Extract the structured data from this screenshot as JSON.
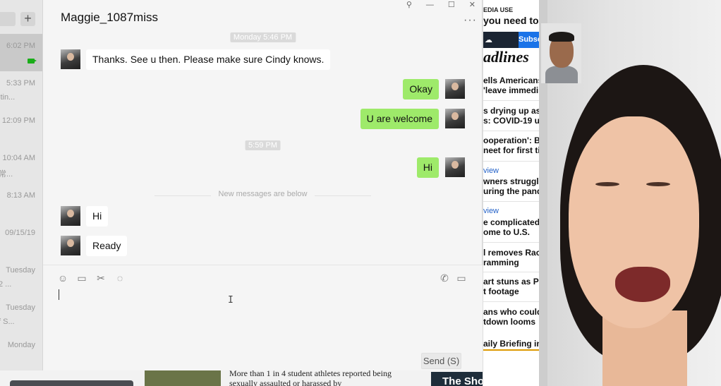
{
  "contacts": {
    "add_label": "+",
    "items": [
      {
        "time": "6:02 PM",
        "snippet": ""
      },
      {
        "time": "5:33 PM",
        "snippet": "itin..."
      },
      {
        "time": "12:09 PM",
        "snippet": ""
      },
      {
        "time": "10:04 AM",
        "snippet": "常..."
      },
      {
        "time": "8:13 AM",
        "snippet": ""
      },
      {
        "time": "09/15/19",
        "snippet": ""
      },
      {
        "time": "Tuesday",
        "snippet": "2 ..."
      },
      {
        "time": "Tuesday",
        "snippet": "f S..."
      },
      {
        "time": "Monday",
        "snippet": ""
      }
    ]
  },
  "chat": {
    "title": "Maggie_1087miss",
    "window_controls": [
      "⚲",
      "—",
      "☐",
      "✕"
    ],
    "more_label": "···",
    "timestamps": [
      "Monday 5:46 PM",
      "5:59 PM"
    ],
    "messages": [
      {
        "side": "in",
        "text": "Thanks. See u then. Please make sure Cindy knows."
      },
      {
        "side": "out",
        "text": "Okay"
      },
      {
        "side": "out",
        "text": "U are welcome"
      },
      {
        "side": "out",
        "text": "Hi"
      },
      {
        "side": "in",
        "text": "Hi"
      },
      {
        "side": "in",
        "text": "Ready"
      }
    ],
    "new_divider": "New messages are below",
    "input_value": "",
    "send_label": "Send (S)",
    "tool_icons": [
      "emoji-icon",
      "folder-icon",
      "scissors-icon",
      "chat-bubble-icon",
      "phone-icon",
      "video-call-icon"
    ]
  },
  "news": {
    "media_label": "EDIA USE",
    "need_label": "you need to",
    "subscribe_label": "Subsc",
    "headlines_label": "adlines",
    "items": [
      {
        "text": "ells Americans"
      },
      {
        "text": "'leave immedi"
      },
      {
        "text": "s drying up as"
      },
      {
        "text": "s: COVID-19 u"
      },
      {
        "text": "ooperation': B"
      },
      {
        "text": "neet for first ti"
      },
      {
        "text": "wners struggle"
      },
      {
        "text": "uring the pand"
      },
      {
        "text": "e complicated i"
      },
      {
        "text": "ome to U.S."
      },
      {
        "text": "l removes Racl"
      },
      {
        "text": "ramming"
      },
      {
        "text": "art stuns as Pr"
      },
      {
        "text": "t footage"
      },
      {
        "text": "ans who could"
      },
      {
        "text": "tdown looms"
      }
    ],
    "tags": [
      "view",
      "view"
    ],
    "briefing": "aily Briefing in"
  },
  "background": {
    "headline": "More than 1 in 4 student athletes reported being sexually assaulted or harassed by",
    "shortlist": "The Short List, in y"
  }
}
